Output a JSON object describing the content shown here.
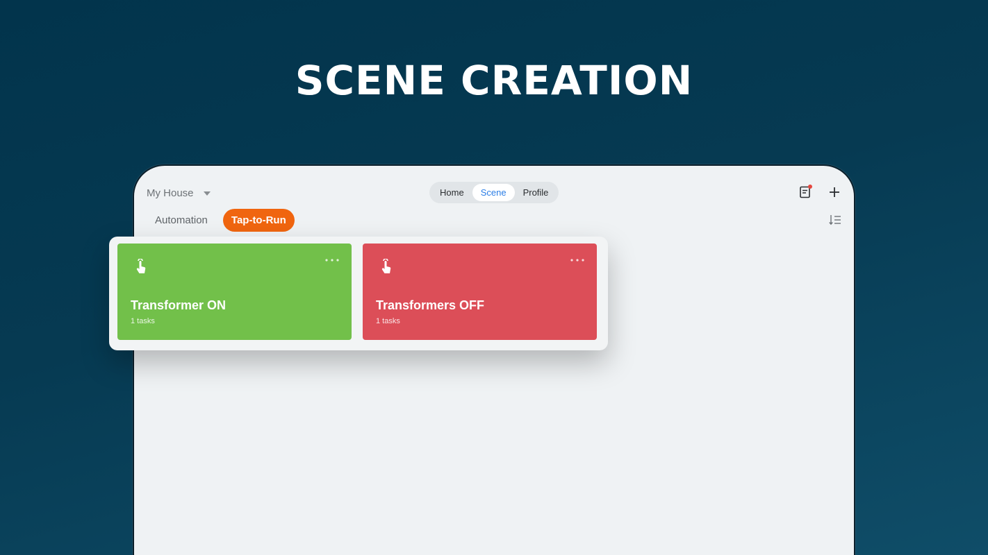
{
  "headline": "SCENE CREATION",
  "home_selector": {
    "label": "My House"
  },
  "nav": {
    "items": [
      {
        "label": "Home",
        "active": false
      },
      {
        "label": "Scene",
        "active": true
      },
      {
        "label": "Profile",
        "active": false
      }
    ]
  },
  "tabs": {
    "automation": "Automation",
    "tap_to_run": "Tap-to-Run"
  },
  "scenes": [
    {
      "name": "Transformer ON",
      "tasks": "1 tasks",
      "color": "#72c04a"
    },
    {
      "name": "Transformers OFF",
      "tasks": "1 tasks",
      "color": "#dc4e58"
    }
  ],
  "icons": {
    "home_dropdown": "chevron-down-icon",
    "notes": "notes-icon",
    "add": "plus-icon",
    "sort": "sort-icon",
    "scene_tap": "tap-hand-icon",
    "scene_more": "more-dots-icon"
  },
  "colors": {
    "accent_orange": "#f0650f",
    "active_blue": "#2b7ee6",
    "notify_red": "#e5473f"
  }
}
